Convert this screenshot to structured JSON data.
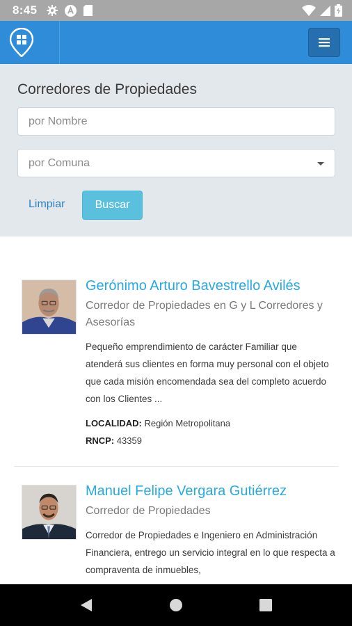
{
  "status_bar": {
    "time": "8:45",
    "left_icons": [
      "settings-icon",
      "a-letter-icon",
      "sd-card-icon"
    ],
    "right_icons": [
      "wifi-icon",
      "cell-signal-icon",
      "battery-icon"
    ]
  },
  "app_bar": {
    "logo_icon": "map-pin-grid-icon",
    "menu_icon": "hamburger-icon",
    "color": "#2e8cd8"
  },
  "search": {
    "title": "Corredores de Propiedades",
    "name_placeholder": "por Nombre",
    "commune_placeholder": "por Comuna",
    "clear_label": "Limpiar",
    "search_label": "Buscar"
  },
  "brokers": [
    {
      "name": "Gerónimo Arturo Bavestrello Avilés",
      "role": "Corredor de Propiedades en G y L Corredores y Asesorías",
      "description": "Pequeño emprendimiento de carácter Familiar que atenderá sus clientes en forma muy personal con el objeto que cada misión encomendada sea del completo acuerdo con los Clientes ...",
      "location_label": "LOCALIDAD:",
      "location": "Región Metropolitana",
      "rncp_label": "RNCP:",
      "rncp": "43359"
    },
    {
      "name": "Manuel Felipe Vergara Gutiérrez",
      "role": "Corredor de Propiedades",
      "description": "Corredor de Propiedades e Ingeniero en Administración Financiera, entrego un servicio integral en lo que respecta a compraventa de inmuebles,"
    }
  ],
  "nav_bar": {
    "icons": [
      "back-icon",
      "home-icon",
      "recents-icon"
    ]
  }
}
